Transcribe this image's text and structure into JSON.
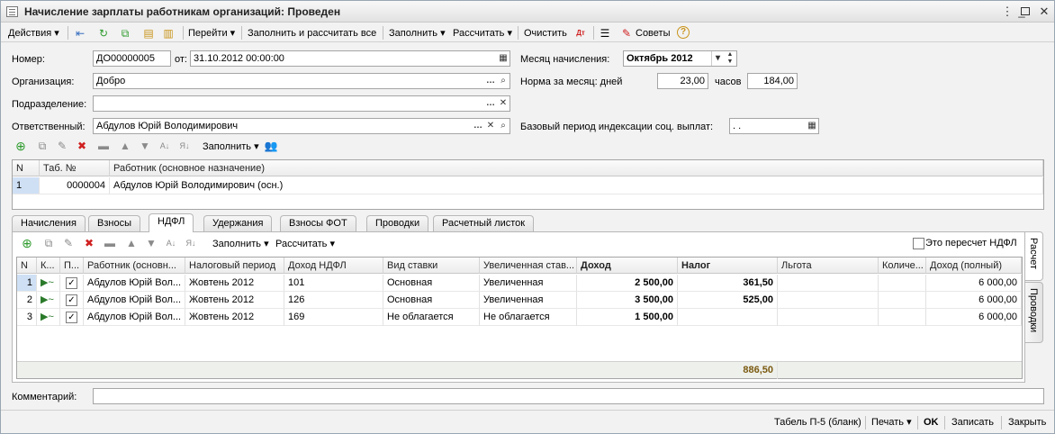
{
  "window": {
    "title": "Начисление зарплаты работникам организаций: Проведен"
  },
  "toolbar": {
    "actions": "Действия",
    "goto": "Перейти",
    "fill_calc_all": "Заполнить и рассчитать все",
    "fill": "Заполнить",
    "calculate": "Рассчитать",
    "clear": "Очистить",
    "tips": "Советы"
  },
  "form": {
    "number_label": "Номер:",
    "number": "ДО00000005",
    "from_label": "от:",
    "date": "31.10.2012 00:00:00",
    "month_label": "Месяц начисления:",
    "month": "Октябрь 2012",
    "org_label": "Организация:",
    "org": "Добро",
    "norm_label": "Норма за месяц: дней",
    "norm_days": "23,00",
    "hours_label": "часов",
    "norm_hours": "184,00",
    "dept_label": "Подразделение:",
    "dept": "",
    "resp_label": "Ответственный:",
    "resp": "Абдулов Юрій Володимирович",
    "base_label": "Базовый период индексации соц. выплат:",
    "base_period": " .  ."
  },
  "employees": {
    "fill_label": "Заполнить",
    "headers": [
      "N",
      "Таб. №",
      "Работник (основное назначение)"
    ],
    "rows": [
      [
        "1",
        "0000004",
        "Абдулов Юрій Володимирович (осн.)"
      ]
    ]
  },
  "tabs": [
    "Начисления",
    "Взносы",
    "НДФЛ",
    "Удержания",
    "Взносы ФОТ",
    "Проводки",
    "Расчетный листок"
  ],
  "active_tab": "НДФЛ",
  "side_tabs": [
    "Расчет",
    "Проводки"
  ],
  "ndfl": {
    "fill_label": "Заполнить",
    "calc_label": "Рассчитать",
    "recalc_label": "Это пересчет НДФЛ",
    "headers": [
      "N",
      "К...",
      "П...",
      "Работник (основн...",
      "Налоговый период",
      "Доход НДФЛ",
      "Вид ставки",
      "Увеличенная став...",
      "Доход",
      "Налог",
      "Льгота",
      "Количе...",
      "Доход (полный)"
    ],
    "rows": [
      [
        "1",
        "",
        "",
        "Абдулов Юрій Вол...",
        "Жовтень 2012",
        "101",
        "Основная",
        "Увеличенная",
        "2 500,00",
        "361,50",
        "",
        "",
        "6 000,00"
      ],
      [
        "2",
        "",
        "",
        "Абдулов Юрій Вол...",
        "Жовтень 2012",
        "126",
        "Основная",
        "Увеличенная",
        "3 500,00",
        "525,00",
        "",
        "",
        "6 000,00"
      ],
      [
        "3",
        "",
        "",
        "Абдулов Юрій Вол...",
        "Жовтень 2012",
        "169",
        "Не облагается",
        "Не облагается",
        "1 500,00",
        "",
        "",
        "",
        "6 000,00"
      ]
    ],
    "total_tax": "886,50"
  },
  "comment": {
    "label": "Комментарий:",
    "value": ""
  },
  "footer": {
    "tabel": "Табель П-5 (бланк)",
    "print": "Печать",
    "ok": "OK",
    "save": "Записать",
    "close": "Закрыть"
  },
  "colors": {
    "accent": "#3a6fc0",
    "selection": "#cfe0f5",
    "total_text": "#7a5a10"
  }
}
